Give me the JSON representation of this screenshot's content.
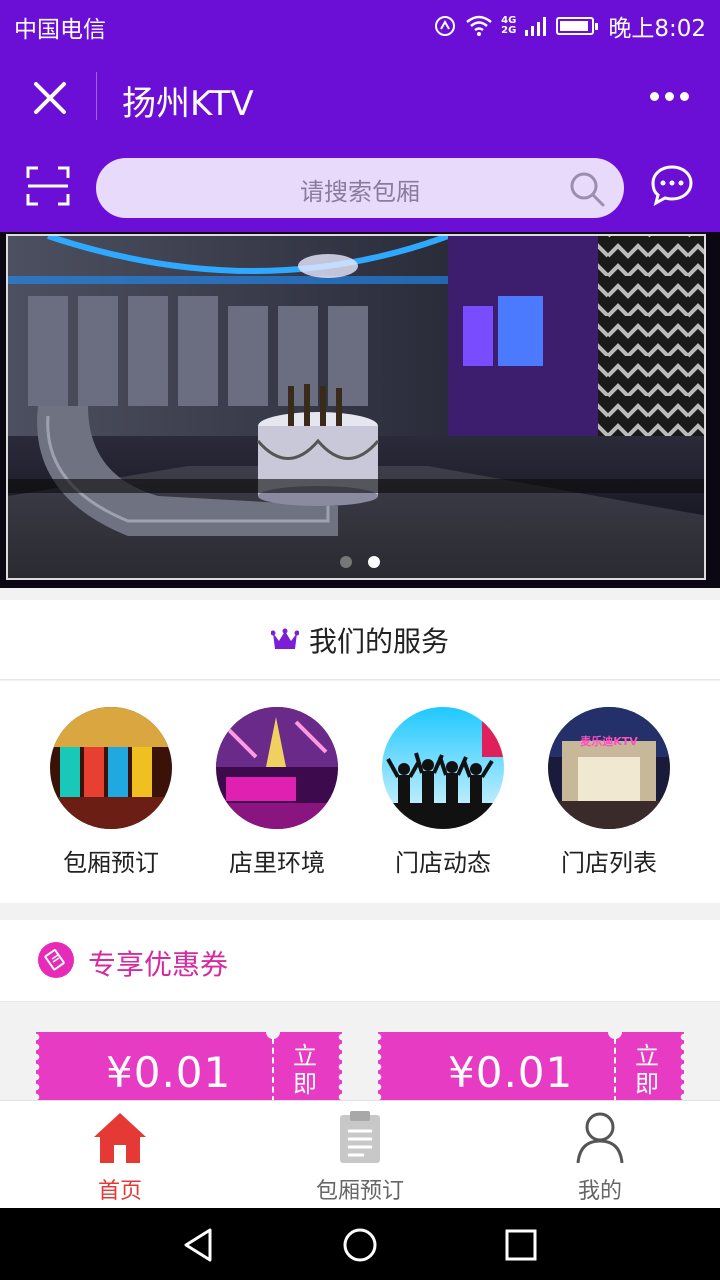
{
  "status_bar": {
    "carrier": "中国电信",
    "network": "4G",
    "network2": "2G",
    "time": "晚上8:02"
  },
  "title_bar": {
    "title": "扬州KTV"
  },
  "search": {
    "placeholder": "请搜索包厢"
  },
  "banner": {
    "active_index": 1,
    "slide_count": 2
  },
  "services": {
    "title": "我们的服务",
    "items": [
      {
        "label": "包厢预订",
        "icon": "room-booking-image"
      },
      {
        "label": "店里环境",
        "icon": "store-environment-image"
      },
      {
        "label": "门店动态",
        "icon": "store-news-image"
      },
      {
        "label": "门店列表",
        "icon": "store-list-image"
      }
    ],
    "store_sign": "麦乐迪KTV"
  },
  "coupons": {
    "title": "专享优惠券",
    "items": [
      {
        "amount": "¥0.01",
        "action": "立即"
      },
      {
        "amount": "¥0.01",
        "action": "立即"
      }
    ]
  },
  "tabbar": {
    "items": [
      {
        "label": "首页",
        "icon": "home-icon",
        "active": true
      },
      {
        "label": "包厢预订",
        "icon": "clipboard-icon",
        "active": false
      },
      {
        "label": "我的",
        "icon": "user-icon",
        "active": false
      }
    ]
  },
  "colors": {
    "primary": "#6c0fd6",
    "coupon": "#e83bc4",
    "active_tab": "#e53935",
    "inactive_tab": "#666666"
  }
}
